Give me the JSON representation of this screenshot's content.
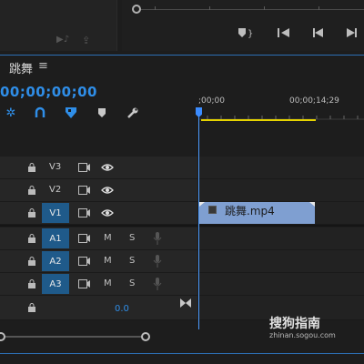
{
  "sequence": {
    "tab_label": "跳舞",
    "menu_icon": "≡",
    "timecode": "00;00;00;00"
  },
  "ruler": {
    "start_label": ";00;00",
    "end_label": "00;00;14;29"
  },
  "tracks": {
    "video": [
      {
        "name": "V3",
        "targeted": false
      },
      {
        "name": "V2",
        "targeted": false
      },
      {
        "name": "V1",
        "targeted": true
      }
    ],
    "audio": [
      {
        "name": "A1",
        "m": "M",
        "s": "S"
      },
      {
        "name": "A2",
        "m": "M",
        "s": "S"
      },
      {
        "name": "A3",
        "m": "M",
        "s": "S"
      }
    ],
    "master_value": "0.0"
  },
  "clip": {
    "label": "跳舞.mp4"
  },
  "watermark": {
    "title": "搜狗指南",
    "url": "zhinan.sogou.com"
  },
  "colors": {
    "accent": "#2f8ee8",
    "clip": "#7f9fd1",
    "work_area": "#e6d300"
  },
  "icons": [
    "snap-icon",
    "linked-selection-icon",
    "add-marker-icon",
    "wrench-icon",
    "lock-icon",
    "film-icon",
    "eye-icon",
    "mic-icon",
    "step-back-icon",
    "play-back-icon",
    "play-forward-icon"
  ]
}
